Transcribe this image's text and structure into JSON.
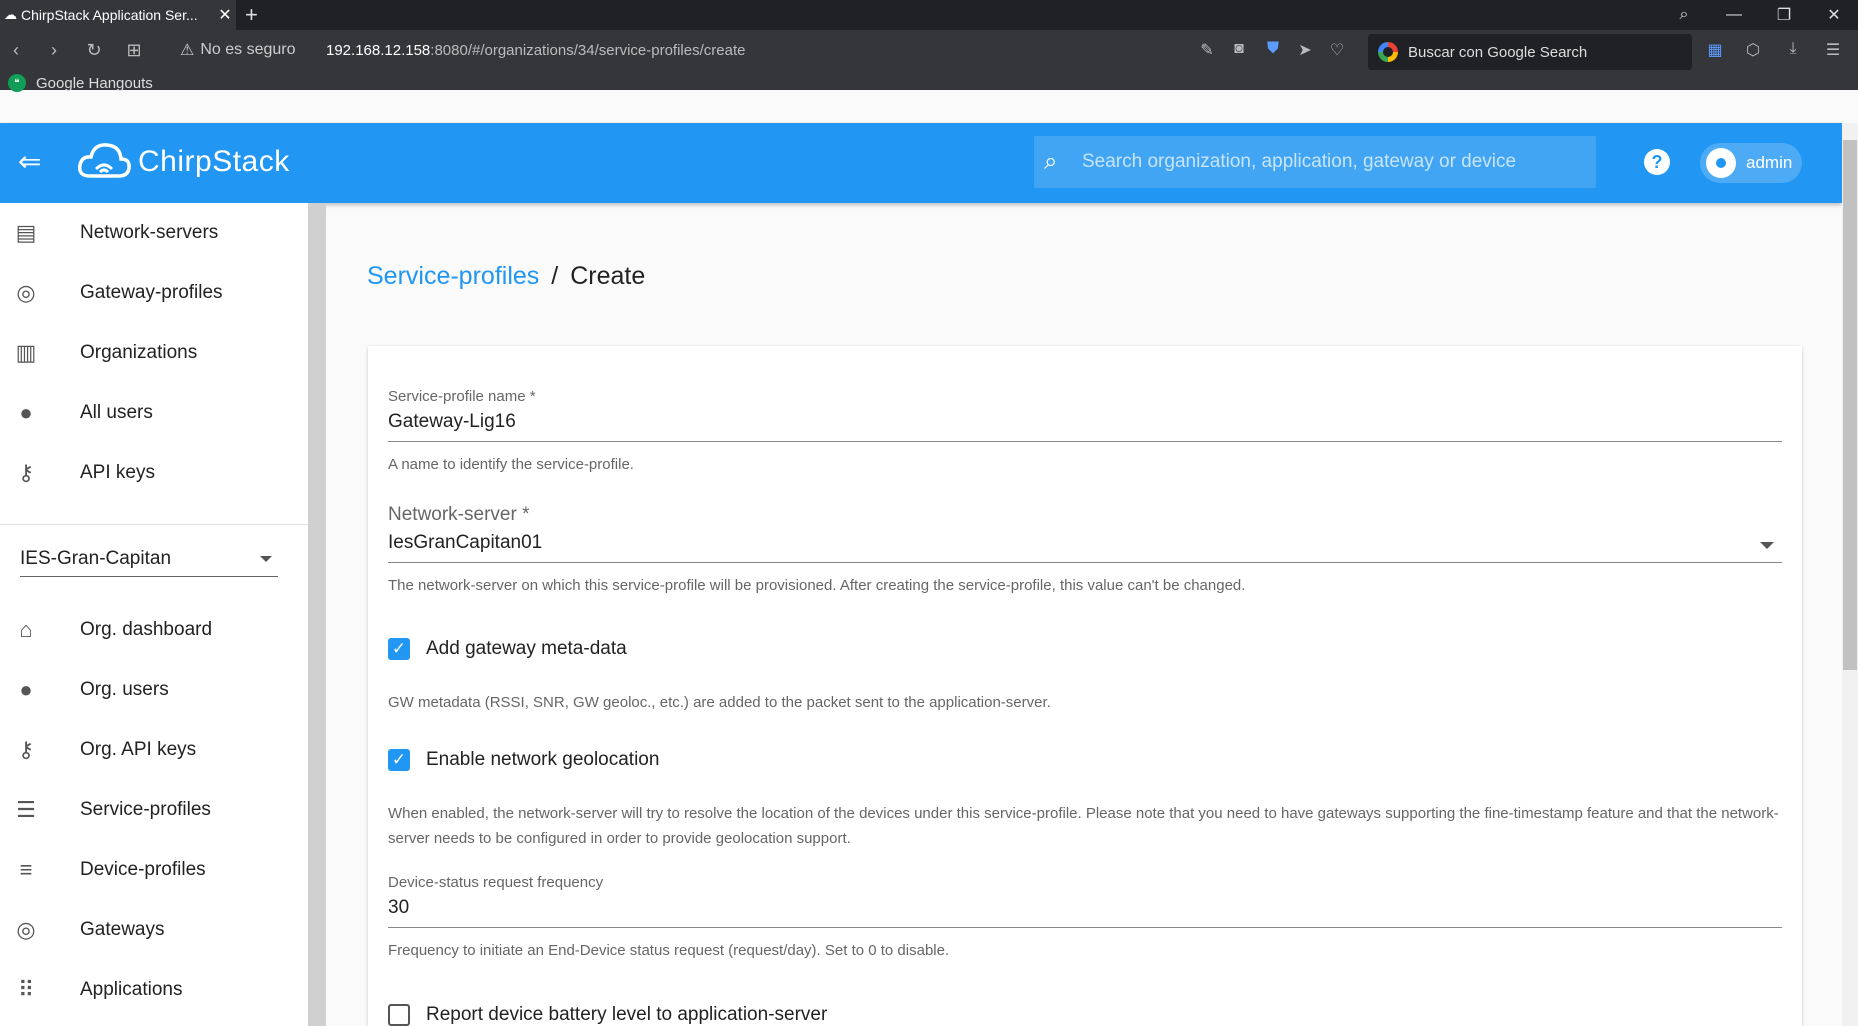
{
  "browser": {
    "tab_title": "ChirpStack Application Ser...",
    "security_label": "No es seguro",
    "url_host": "192.168.12.158",
    "url_rest": ":8080/#/organizations/34/service-profiles/create",
    "search_engine_placeholder": "Buscar con Google Search",
    "bookmark": "Google Hangouts"
  },
  "header": {
    "brand": "ChirpStack",
    "search_placeholder": "Search organization, application, gateway or device",
    "user": "admin"
  },
  "sidebar": {
    "global_items": [
      {
        "label": "Network-servers",
        "icon": "server-icon"
      },
      {
        "label": "Gateway-profiles",
        "icon": "antenna-icon"
      },
      {
        "label": "Organizations",
        "icon": "building-icon"
      },
      {
        "label": "All users",
        "icon": "person-icon"
      },
      {
        "label": "API keys",
        "icon": "key-icon"
      }
    ],
    "organization": "IES-Gran-Capitan",
    "org_items": [
      {
        "label": "Org. dashboard",
        "icon": "home-icon"
      },
      {
        "label": "Org. users",
        "icon": "person-icon"
      },
      {
        "label": "Org. API keys",
        "icon": "key-icon"
      },
      {
        "label": "Service-profiles",
        "icon": "list-person-icon"
      },
      {
        "label": "Device-profiles",
        "icon": "tune-icon"
      },
      {
        "label": "Gateways",
        "icon": "antenna-icon"
      },
      {
        "label": "Applications",
        "icon": "apps-grid-icon"
      }
    ]
  },
  "breadcrumb": {
    "parent": "Service-profiles",
    "separator": "/",
    "current": "Create"
  },
  "form": {
    "name": {
      "label": "Service-profile name *",
      "value": "Gateway-Lig16",
      "helper": "A name to identify the service-profile."
    },
    "network_server": {
      "label": "Network-server *",
      "value": "IesGranCapitan01",
      "helper": "The network-server on which this service-profile will be provisioned. After creating the service-profile, this value can't be changed."
    },
    "gateway_metadata": {
      "label": "Add gateway meta-data",
      "checked": true,
      "helper": "GW metadata (RSSI, SNR, GW geoloc., etc.) are added to the packet sent to the application-server."
    },
    "geolocation": {
      "label": "Enable network geolocation",
      "checked": true,
      "helper": "When enabled, the network-server will try to resolve the location of the devices under this service-profile. Please note that you need to have gateways supporting the fine-timestamp feature and that the network-server needs to be configured in order to provide geolocation support."
    },
    "dev_status_freq": {
      "label": "Device-status request frequency",
      "value": "30",
      "helper": "Frequency to initiate an End-Device status request (request/day). Set to 0 to disable."
    },
    "battery_report": {
      "label": "Report device battery level to application-server",
      "checked": false
    }
  }
}
